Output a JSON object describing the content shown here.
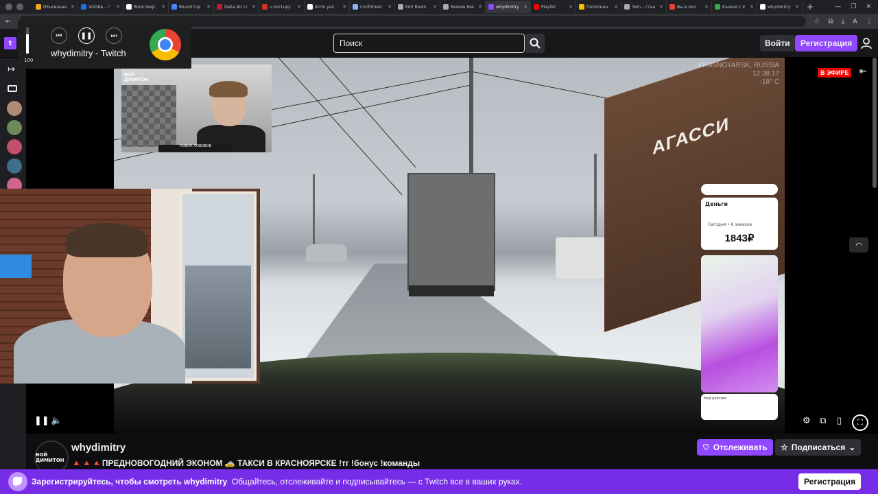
{
  "browser": {
    "tabs": [
      {
        "label": "ПЕнсильва",
        "color": "#f5a623"
      },
      {
        "label": "VODKA – г",
        "color": "#1a73e8"
      },
      {
        "label": "Boris brejc",
        "color": "#ffffff"
      },
      {
        "label": "Round trip",
        "color": "#4285f4"
      },
      {
        "label": "Delta Air Li",
        "color": "#c01933"
      },
      {
        "label": "u.nor1upy",
        "color": "#d93025"
      },
      {
        "label": "Archi yan",
        "color": "#ffffff"
      },
      {
        "label": "Confirmed",
        "color": "#8ab4f8"
      },
      {
        "label": "Edit Room",
        "color": "#aaaaaa"
      },
      {
        "label": "Review Res",
        "color": "#aaaaaa"
      },
      {
        "label": "whydimitry",
        "color": "#9147ff",
        "active": true
      },
      {
        "label": "Playlist",
        "color": "#ff0000"
      },
      {
        "label": "Пополнен",
        "color": "#fbbc04"
      },
      {
        "label": "Twin – стан",
        "color": "#aaaaaa"
      },
      {
        "label": "Вы в пол",
        "color": "#ea4335"
      },
      {
        "label": "Казино с Е",
        "color": "#34a853"
      },
      {
        "label": "whydimitry",
        "color": "#ffffff"
      }
    ],
    "new_tab": "+"
  },
  "media_card": {
    "title": "whydimitry - Twitch",
    "volume": "100",
    "volume_level": 0.74
  },
  "topnav": {
    "search_placeholder": "Поиск",
    "login_label": "Войти",
    "signup_label": "Регистрация"
  },
  "player": {
    "live_label": "В ЭФИРЕ",
    "overlay_city": "KRASNOYARSK, RUSSIA",
    "overlay_time": "12:38:17",
    "overlay_temp": "-18° C",
    "sign_text": "АГАССИ",
    "facecam_label_1": "ВОЙ",
    "facecam_label_2": "ДИМИТОН",
    "facecam_bar": "НОВОК ЛОВОВОВ",
    "phone": {
      "section": "Деньги",
      "today": "Сегодня • 6 заказов",
      "amount": "1843₽",
      "bottom_label": "Мой рейтинг"
    }
  },
  "channel": {
    "avatar_label": "ВОЙ ДИМИТОН",
    "name": "whydimitry",
    "title": "🔺🔺🔺ПРЕДНОВОГОДНИЙ ЭКОНОМ 🚕 ТАКСИ В КРАСНОЯРСКЕ !тг !бонус !команды",
    "follow_label": "Отслеживать",
    "subscribe_label": "Подписаться"
  },
  "banner": {
    "prefix": "Зарегистрируйтесь, чтобы смотреть whydimitry",
    "message": "Общайтесь, отслеживайте и подписывайтесь — с Twitch все в ваших руках.",
    "button": "Регистрация"
  },
  "colors": {
    "twitch_purple": "#9147ff",
    "banner_purple": "#772ce8",
    "live_red": "#eb0400"
  }
}
